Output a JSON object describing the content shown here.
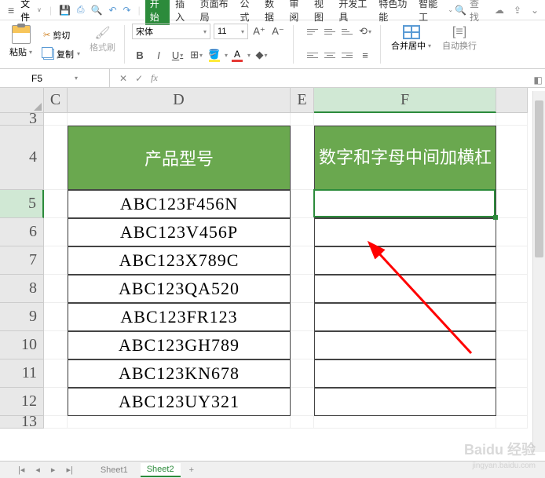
{
  "menu": {
    "file": "文件",
    "tabs": [
      "开始",
      "插入",
      "页面布局",
      "公式",
      "数据",
      "审阅",
      "视图",
      "开发工具",
      "特色功能",
      "智能工"
    ],
    "search": "查找"
  },
  "ribbon": {
    "paste": "粘贴",
    "cut": "剪切",
    "copy": "复制",
    "format_painter": "格式刷",
    "font_name": "宋体",
    "font_size": "11",
    "merge": "合并居中",
    "wrap": "自动换行"
  },
  "namebox": {
    "cell_ref": "F5"
  },
  "columns": [
    "C",
    "D",
    "E",
    "F"
  ],
  "rows": [
    "3",
    "4",
    "5",
    "6",
    "7",
    "8",
    "9",
    "10",
    "11",
    "12",
    "13"
  ],
  "row_heights": {
    "3": 16,
    "4": 82,
    "5": 36,
    "6": 36,
    "7": 36,
    "8": 36,
    "9": 36,
    "10": 36,
    "11": 36,
    "12": 36,
    "13": 16
  },
  "table": {
    "header_d": "产品型号",
    "header_f": "数字和字母中间加横杠",
    "data_d": [
      "ABC123F456N",
      "ABC123V456P",
      "ABC123X789C",
      "ABC123QA520",
      "ABC123FR123",
      "ABC123GH789",
      "ABC123KN678",
      "ABC123UY321"
    ]
  },
  "sheet_tabs": {
    "prev": "Sheet1",
    "active": "Sheet2"
  },
  "colors": {
    "green_header": "#6aa84f",
    "accent": "#2c8b3b"
  },
  "watermark": {
    "main": "Baidu 经验",
    "sub": "jingyan.baidu.com"
  },
  "chart_data": {
    "type": "table",
    "columns": [
      "产品型号",
      "数字和字母中间加横杠"
    ],
    "rows": [
      [
        "ABC123F456N",
        ""
      ],
      [
        "ABC123V456P",
        ""
      ],
      [
        "ABC123X789C",
        ""
      ],
      [
        "ABC123QA520",
        ""
      ],
      [
        "ABC123FR123",
        ""
      ],
      [
        "ABC123GH789",
        ""
      ],
      [
        "ABC123KN678",
        ""
      ],
      [
        "ABC123UY321",
        ""
      ]
    ]
  }
}
